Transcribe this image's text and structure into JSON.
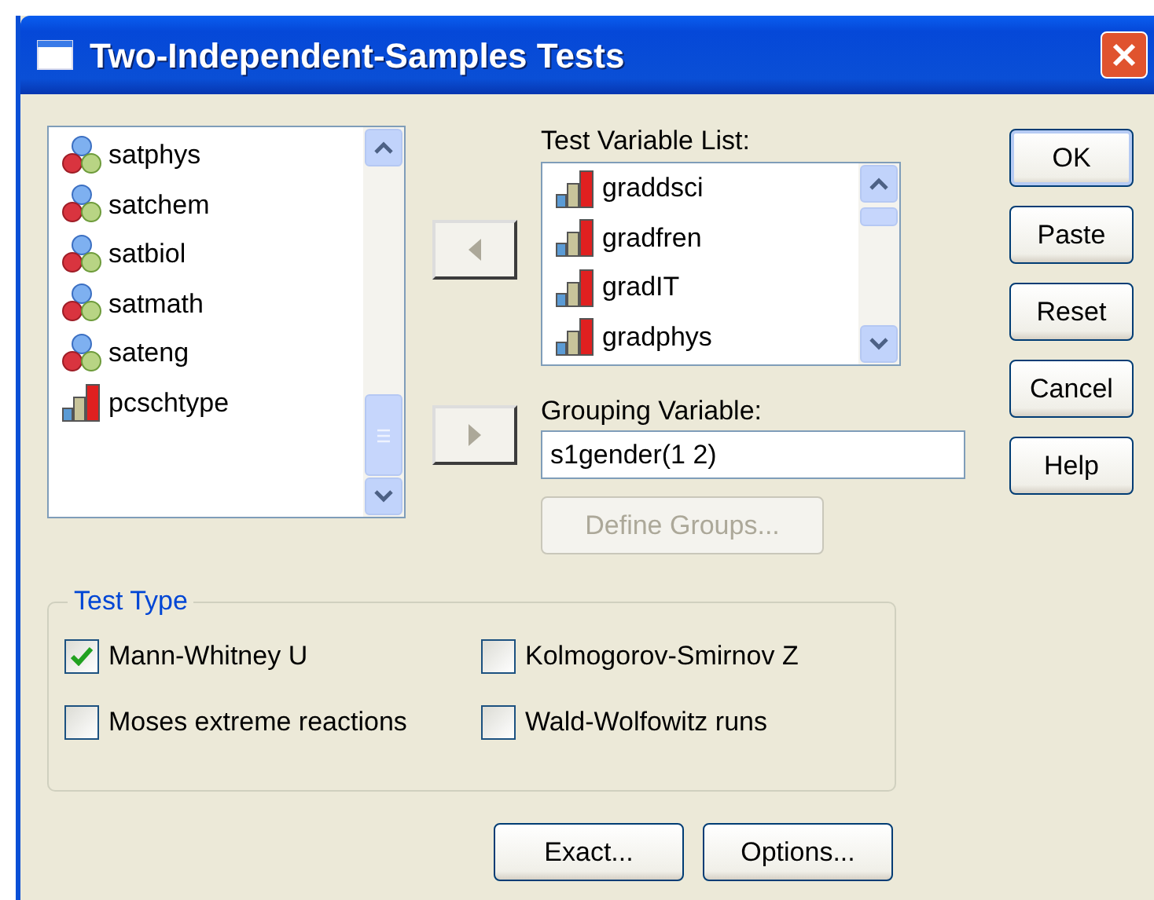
{
  "window": {
    "title": "Two-Independent-Samples Tests"
  },
  "source_variables": [
    {
      "name": "satphys",
      "kind": "scale"
    },
    {
      "name": "satchem",
      "kind": "scale"
    },
    {
      "name": "satbiol",
      "kind": "scale"
    },
    {
      "name": "satmath",
      "kind": "scale"
    },
    {
      "name": "sateng",
      "kind": "scale"
    },
    {
      "name": "pcschtype",
      "kind": "ordinal"
    }
  ],
  "test_variable_list": {
    "label": "Test Variable List:",
    "items": [
      {
        "name": "graddsci",
        "kind": "ordinal"
      },
      {
        "name": "gradfren",
        "kind": "ordinal"
      },
      {
        "name": "gradIT",
        "kind": "ordinal"
      },
      {
        "name": "gradphys",
        "kind": "ordinal"
      }
    ]
  },
  "grouping_variable": {
    "label": "Grouping Variable:",
    "value": "s1gender(1 2)"
  },
  "define_groups_button": {
    "label": "Define Groups...",
    "disabled": true
  },
  "side_buttons": [
    "OK",
    "Paste",
    "Reset",
    "Cancel",
    "Help"
  ],
  "test_type": {
    "title": "Test Type",
    "options": [
      {
        "label": "Mann-Whitney U",
        "checked": true
      },
      {
        "label": "Kolmogorov-Smirnov Z",
        "checked": false
      },
      {
        "label": "Moses extreme reactions",
        "checked": false
      },
      {
        "label": "Wald-Wolfowitz runs",
        "checked": false
      }
    ]
  },
  "bottom_buttons": [
    "Exact...",
    "Options..."
  ]
}
